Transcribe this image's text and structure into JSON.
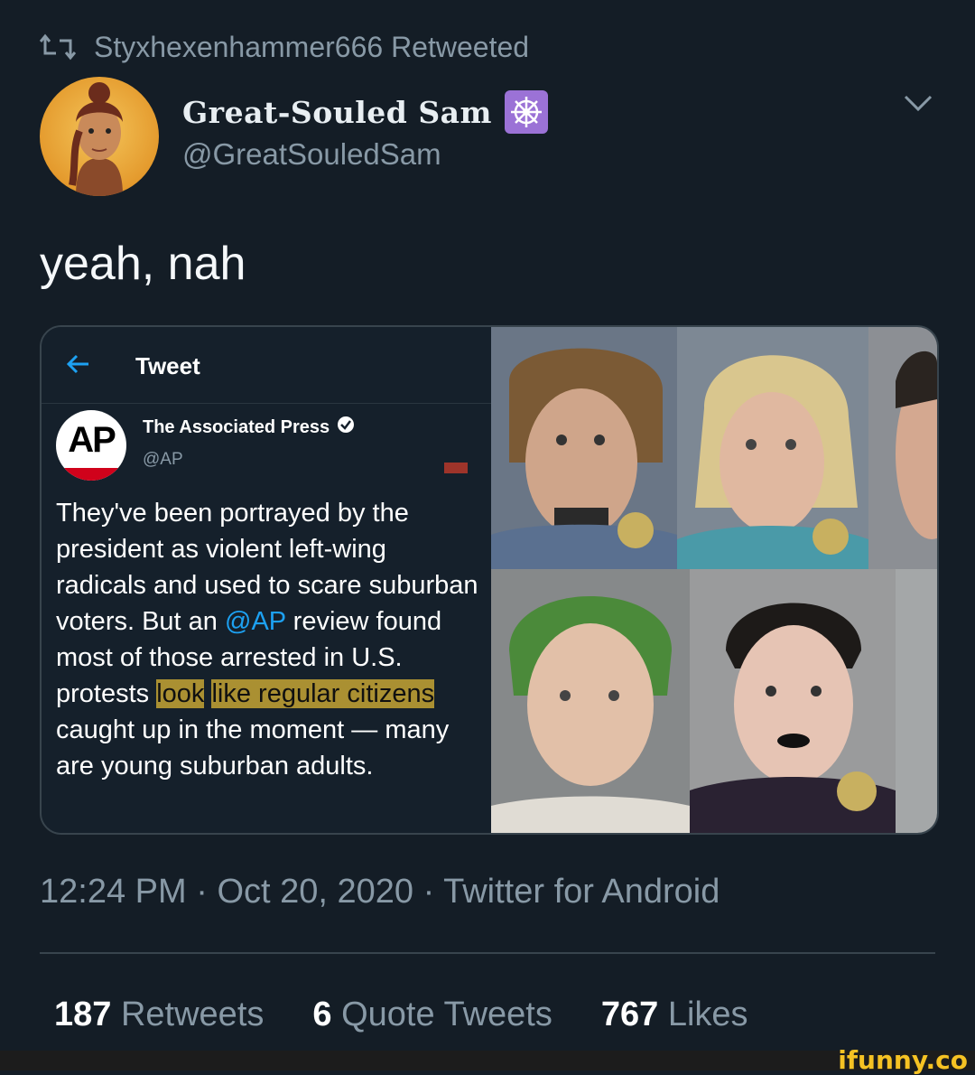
{
  "retweet": {
    "icon": "retweet-icon",
    "text": "Styxhexenhammer666 Retweeted"
  },
  "author": {
    "display_name": "Great-Souled Sam",
    "badge_icon": "dharma-wheel-icon",
    "handle": "@GreatSouledSam",
    "avatar": "avatar-illustration"
  },
  "tweet": {
    "text": "yeah, nah"
  },
  "quoted": {
    "header_title": "Tweet",
    "back_icon": "back-arrow-icon",
    "name": "The Associated Press",
    "verified_icon": "verified-icon",
    "handle": "@AP",
    "logo_text": "AP",
    "body_part1": "They've been portrayed by the president as violent left-wing radicals and used to scare suburban voters. But an ",
    "body_link": "@AP",
    "body_part2": " review found most of those arrested in U.S. protests ",
    "body_highlight1": "look",
    "body_highlight2": "like regular citizens",
    "body_part3": " caught up in the moment — many are young suburban adults.",
    "photos": [
      "mugshot-1",
      "mugshot-2",
      "mugshot-3",
      "mugshot-4",
      "mugshot-5"
    ]
  },
  "meta": {
    "time": "12:24 PM",
    "date": "Oct 20, 2020",
    "client": "Twitter for Android",
    "separator": "·"
  },
  "stats": {
    "retweets_count": "187",
    "retweets_label": "Retweets",
    "quotes_count": "6",
    "quotes_label": "Quote Tweets",
    "likes_count": "767",
    "likes_label": "Likes"
  },
  "watermark": "ifunny.co",
  "colors": {
    "background": "#141d26",
    "link": "#1da1f2",
    "highlight": "#c4a434",
    "badge": "#9b72d6"
  }
}
